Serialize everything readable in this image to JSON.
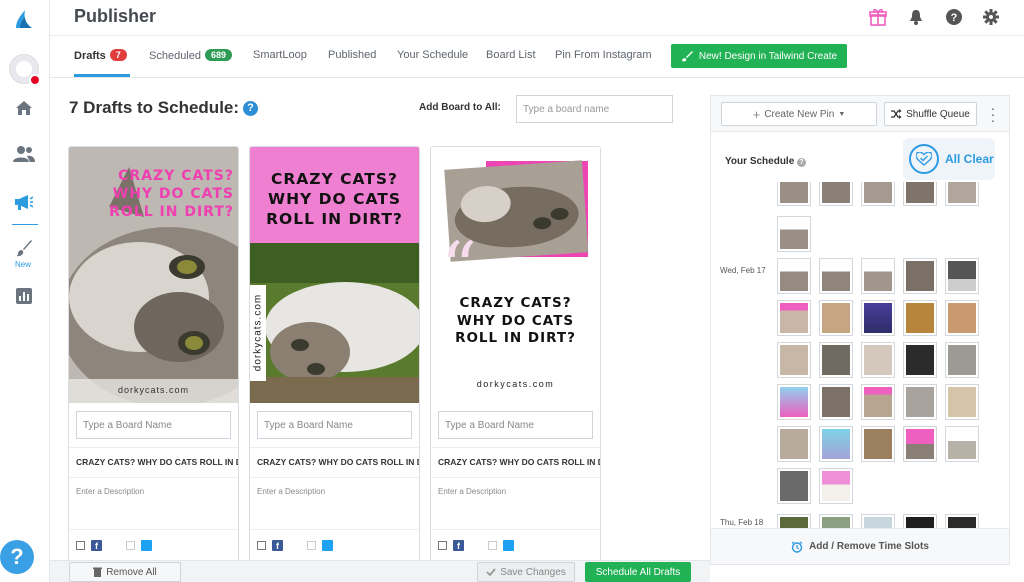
{
  "header": {
    "title": "Publisher"
  },
  "rail": {
    "new_label": "New",
    "help_label": "?"
  },
  "tabs": [
    {
      "label": "Drafts",
      "badge": "7"
    },
    {
      "label": "Scheduled",
      "badge": "689"
    },
    {
      "label": "SmartLoop"
    },
    {
      "label": "Published"
    },
    {
      "label": "Your Schedule"
    },
    {
      "label": "Board List"
    },
    {
      "label": "Pin From Instagram"
    }
  ],
  "new_design_label": "New! Design in Tailwind Create",
  "drafts": {
    "title": "7 Drafts to Schedule:",
    "help": "?",
    "add_board_label": "Add Board to All:",
    "add_board_placeholder": "Type a board name"
  },
  "cards": [
    {
      "image_text": "CRAZY CATS? WHY DO CATS ROLL IN DIRT?",
      "watermark": "dorkycats.com",
      "board_placeholder": "Type a Board Name",
      "pin_title": "CRAZY CATS? WHY DO CATS ROLL IN DIRT?",
      "description_placeholder": "Enter a Description"
    },
    {
      "image_text": "CRAZY CATS? WHY DO CATS ROLL IN DIRT?",
      "watermark": "dorkycats.com",
      "board_placeholder": "Type a Board Name",
      "pin_title": "CRAZY CATS? WHY DO CATS ROLL IN DIRT?",
      "description_placeholder": "Enter a Description"
    },
    {
      "image_text": "CRAZY CATS? WHY DO CATS ROLL IN DIRT?",
      "watermark": "dorkycats.com",
      "board_placeholder": "Type a Board Name",
      "pin_title": "CRAZY CATS? WHY DO CATS ROLL IN DIRT?",
      "description_placeholder": "Enter a Description"
    }
  ],
  "bottom": {
    "remove_all": "Remove All",
    "save_changes": "Save Changes",
    "schedule_all": "Schedule All Drafts"
  },
  "panel": {
    "create_pin": "Create New Pin",
    "shuffle": "Shuffle Queue",
    "schedule_title": "Your Schedule",
    "all_clear": "All Clear",
    "day1": "Wed, Feb 17",
    "day2": "Thu, Feb 18",
    "footer": "Add / Remove Time Slots"
  },
  "colors": {
    "accent_blue": "#2d9be0",
    "green": "#21b256",
    "pink": "#ef5fbf",
    "badge_red": "#e23d3d"
  }
}
